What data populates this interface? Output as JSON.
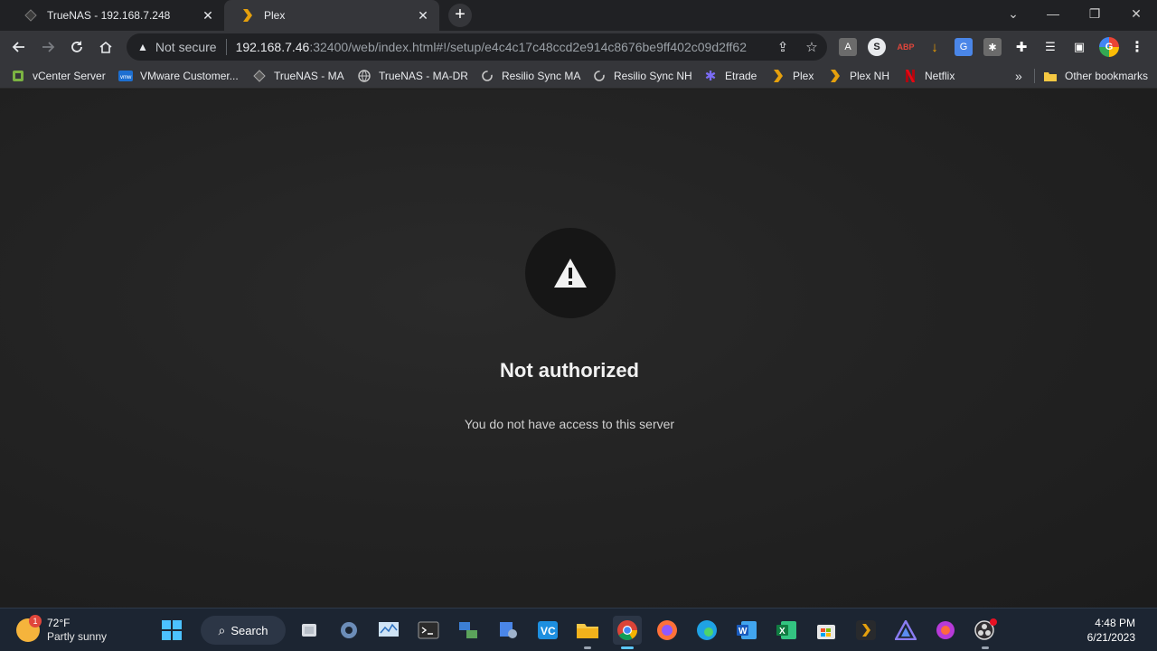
{
  "browser": {
    "tabs": [
      {
        "title": "TrueNAS - 192.168.7.248",
        "active": false
      },
      {
        "title": "Plex",
        "active": true
      }
    ],
    "window_controls": {
      "tab_search": "⌄",
      "minimize": "—",
      "restore": "❐",
      "close": "✕"
    },
    "address_bar": {
      "security_label": "Not secure",
      "url_host": "192.168.7.46",
      "url_rest": ":32400/web/index.html#!/setup/e4c4c17c48ccd2e914c8676be9ff402c09d2ff62"
    },
    "bookmarks": [
      {
        "label": "vCenter Server",
        "icon": "vcenter-icon"
      },
      {
        "label": "VMware Customer...",
        "icon": "vmware-icon"
      },
      {
        "label": "TrueNAS - MA",
        "icon": "truenas-icon"
      },
      {
        "label": "TrueNAS - MA-DR",
        "icon": "globe-icon"
      },
      {
        "label": "Resilio Sync MA",
        "icon": "resilio-icon"
      },
      {
        "label": "Resilio Sync NH",
        "icon": "resilio-icon"
      },
      {
        "label": "Etrade",
        "icon": "etrade-icon"
      },
      {
        "label": "Plex",
        "icon": "plex-icon"
      },
      {
        "label": "Plex NH",
        "icon": "plex-icon"
      },
      {
        "label": "Netflix",
        "icon": "netflix-icon"
      }
    ],
    "bookmarks_overflow": "»",
    "other_bookmarks": "Other bookmarks"
  },
  "page": {
    "headline": "Not authorized",
    "message": "You do not have access to this server"
  },
  "taskbar": {
    "weather_temp": "72°F",
    "weather_desc": "Partly sunny",
    "weather_badge": "1",
    "search_label": "Search",
    "time": "4:48 PM",
    "date": "6/21/2023"
  },
  "colors": {
    "plex_accent": "#e5a00d",
    "taskbar_active": "#5cc8ff"
  }
}
